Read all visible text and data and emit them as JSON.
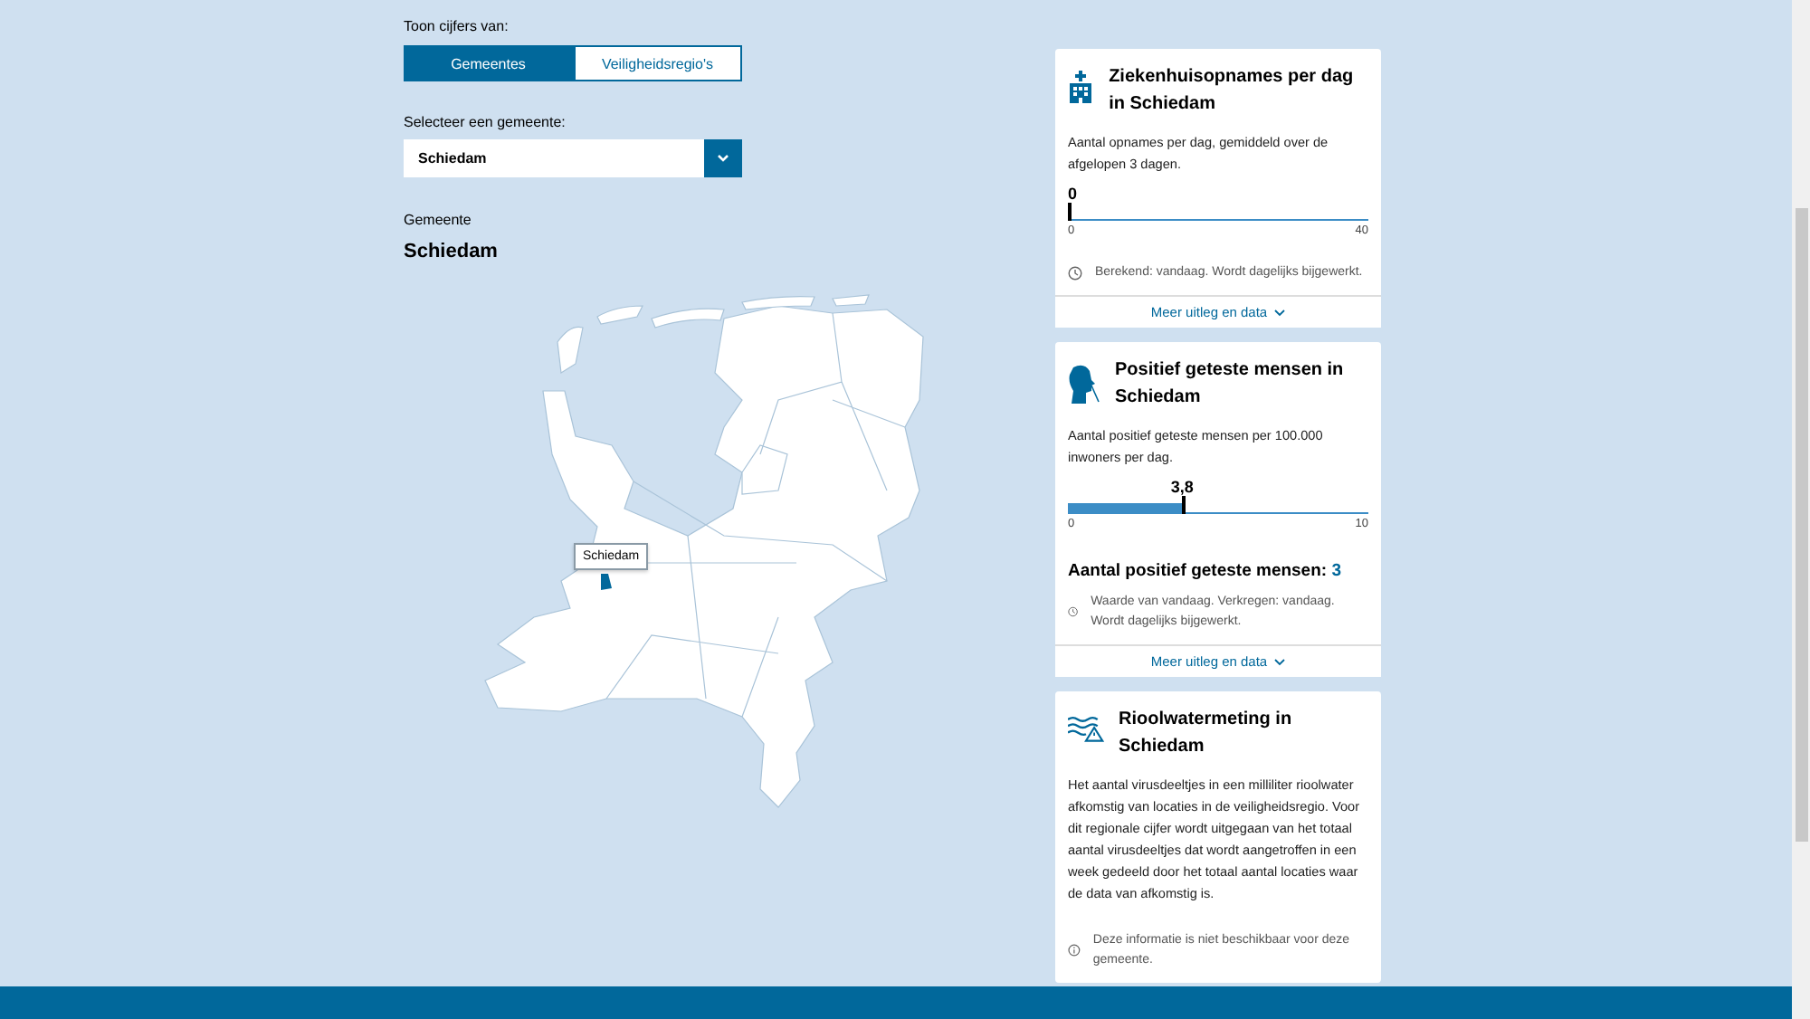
{
  "filter": {
    "label": "Toon cijfers van:",
    "tabs": [
      {
        "label": "Gemeentes",
        "selected": true
      },
      {
        "label": "Veiligheidsregio's",
        "selected": false
      }
    ]
  },
  "select": {
    "label": "Selecteer een gemeente:",
    "value": "Schiedam"
  },
  "area": {
    "label": "Gemeente",
    "name": "Schiedam"
  },
  "map": {
    "tooltip": "Schiedam"
  },
  "cards": [
    {
      "kind": "gauge",
      "title": "Ziekenhuisopnames per dag in Schiedam",
      "description": "Aantal opnames per dag, gemiddeld over de afgelopen 3 dagen.",
      "value": "0",
      "level": 0,
      "min": "0",
      "max": "40",
      "note": "Berekend: vandaag. Wordt dagelijks bijgewerkt.",
      "link": "Meer uitleg en data"
    },
    {
      "kind": "gauge",
      "title": "Positief geteste mensen in Schiedam",
      "description": "Aantal positief geteste mensen per 100.000 inwoners per dag.",
      "value": "3,8",
      "level": 0.38,
      "min": "0",
      "max": "10",
      "total_label": "Aantal positief geteste mensen:",
      "total_value": "3",
      "note": "Waarde van vandaag. Verkregen: vandaag. Wordt dagelijks bijgewerkt.",
      "link": "Meer uitleg en data"
    },
    {
      "kind": "text",
      "title": "Rioolwatermeting in Schiedam",
      "description": "Het aantal virusdeeltjes in een milliliter rioolwater afkomstig van locaties in de veiligheidsregio. Voor dit regionale cijfer wordt uitgegaan van het totaal aantal virusdeeltjes dat wordt aangetroffen in een week gedeeld door het totaal aantal locaties waar de data van afkomstig is.",
      "note": "Deze informatie is niet beschikbaar voor deze gemeente."
    }
  ]
}
